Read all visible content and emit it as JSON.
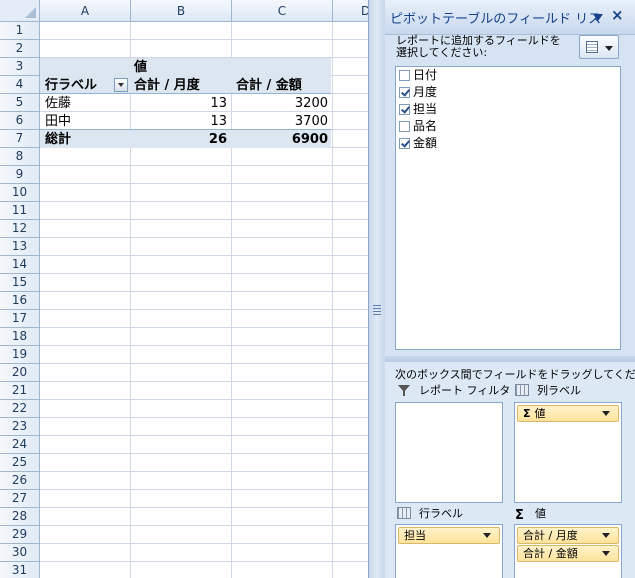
{
  "sheet": {
    "columns": [
      "A",
      "B",
      "C",
      "D"
    ],
    "rows": [
      "1",
      "2",
      "3",
      "4",
      "5",
      "6",
      "7",
      "8",
      "9",
      "10",
      "11",
      "12",
      "13",
      "14",
      "15",
      "16",
      "17",
      "18",
      "19",
      "20",
      "21",
      "22",
      "23",
      "24",
      "25",
      "26",
      "27",
      "28",
      "29",
      "30",
      "31"
    ],
    "pivot": {
      "value_header": "値",
      "row_label": "行ラベル",
      "col_b_header": "合計 / 月度",
      "col_c_header": "合計 / 金額",
      "rows": [
        {
          "label": "佐藤",
          "b": "13",
          "c": "3200"
        },
        {
          "label": "田中",
          "b": "13",
          "c": "3700"
        }
      ],
      "total": {
        "label": "総計",
        "b": "26",
        "c": "6900"
      }
    }
  },
  "pane": {
    "title": "ピボットテーブルのフィールド リス",
    "close_label": "×",
    "instruction": "レポートに追加するフィールドを選択してください:",
    "fields": [
      {
        "label": "日付",
        "checked": false
      },
      {
        "label": "月度",
        "checked": true
      },
      {
        "label": "担当",
        "checked": true
      },
      {
        "label": "品名",
        "checked": false
      },
      {
        "label": "金額",
        "checked": true
      }
    ],
    "drag_instruction": "次のボックス間でフィールドをドラッグしてください:",
    "areas": {
      "report_filter": "レポート フィルタ",
      "column_labels": "列ラベル",
      "row_labels": "行ラベル",
      "values": "値",
      "sigma": "Σ"
    },
    "column_items": [
      "値"
    ],
    "row_items": [
      "担当"
    ],
    "value_items": [
      "合計 / 月度",
      "合計 / 金額"
    ]
  }
}
